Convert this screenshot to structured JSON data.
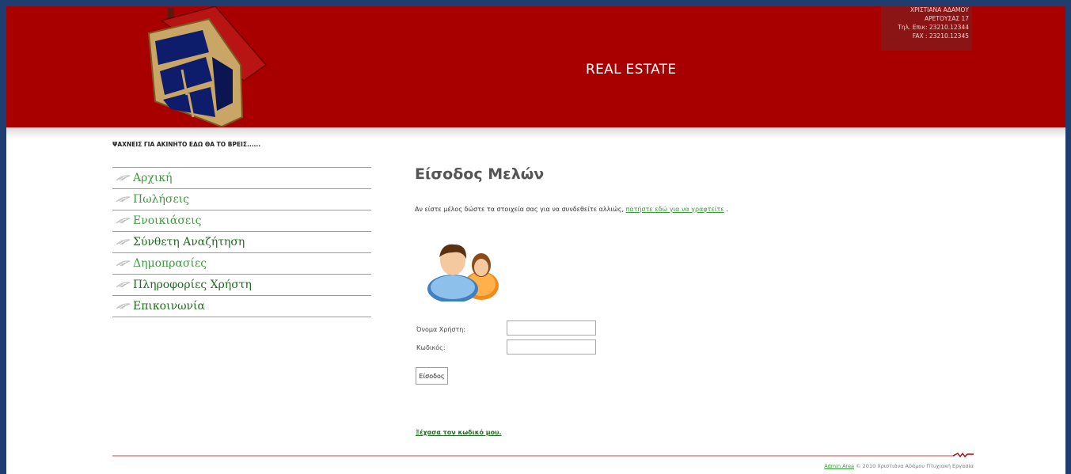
{
  "header": {
    "site_title": "REAL ESTATE",
    "contact": {
      "name": "ΧΡΙΣΤΙΑΝΑ ΑΔΑΜΟΥ",
      "address": "ΑΡΕΤΟΥΣΑΣ 17",
      "phone": "Τηλ. Επικ: 23210.12344",
      "fax": "FAX : 23210.12345"
    },
    "logo_icon": "house-icon",
    "colors": {
      "header_bg": "#a80000",
      "contact_bg": "#8b1515"
    }
  },
  "tagline": "ΨΑΧΝΕΙΣ ΓΙΑ ΑΚΙΝΗΤΟ ΕΔΩ ΘΑ ΤΟ ΒΡΕΙΣ......",
  "sidebar": {
    "items": [
      {
        "label": "Αρχική"
      },
      {
        "label": "Πωλήσεις"
      },
      {
        "label": "Ενοικιάσεις"
      },
      {
        "label": "Σύνθετη Αναζήτηση"
      },
      {
        "label": "Δημοπρασίες"
      },
      {
        "label": "Πληροφορίες Χρήστη"
      },
      {
        "label": "Επικοινωνία"
      }
    ],
    "link_color": "#3e9a3e",
    "active_color": "#1f6b1f"
  },
  "main": {
    "title": "Είσοδος Μελών",
    "intro_text": "Αν είστε μέλος δώστε τα στοιχεία σας για να συνδεθείτε αλλιώς,",
    "register_link": "πατήστε εδώ για να γραφτείτε",
    "intro_end": ".",
    "users_icon": "users-icon",
    "form": {
      "username_label": "Όνομα Χρήστη:",
      "username_value": "",
      "password_label": "Κωδικός:",
      "password_value": "",
      "submit_label": "Είσοδος"
    },
    "forgot_link": "Ξέχασα τον κωδικό μου."
  },
  "footer": {
    "admin_link": "Admin Area",
    "copyright": "© 2010 Χριστιάνα Αδάμου Πτυχιακή Εργασία"
  }
}
